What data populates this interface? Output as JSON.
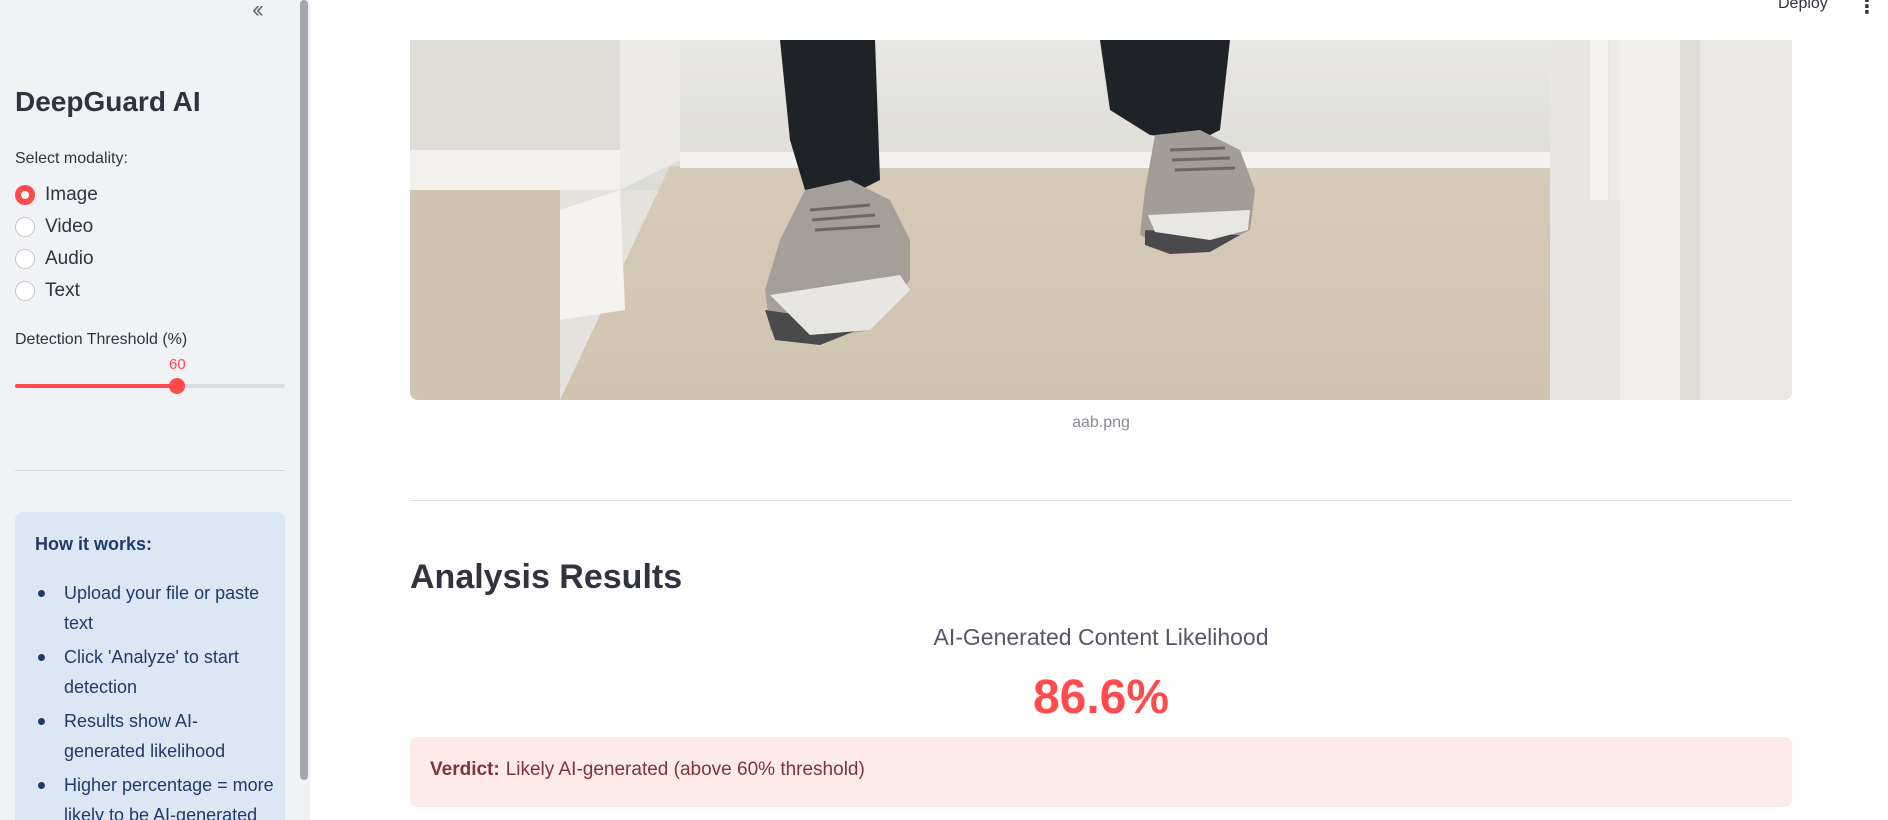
{
  "sidebar": {
    "collapse_icon": "double-chevron-left-icon",
    "title": "DeepGuard AI",
    "modality_label": "Select modality:",
    "modalities": [
      {
        "label": "Image",
        "selected": true
      },
      {
        "label": "Video",
        "selected": false
      },
      {
        "label": "Audio",
        "selected": false
      },
      {
        "label": "Text",
        "selected": false
      }
    ],
    "threshold_label": "Detection Threshold (%)",
    "threshold_value": "60",
    "threshold": {
      "value": 60,
      "min": 0,
      "max": 100
    },
    "info": {
      "title": "How it works:",
      "items": [
        "Upload your file or paste text",
        "Click 'Analyze' to start detection",
        "Results show AI-generated likelihood",
        "Higher percentage = more likely to be AI-generated"
      ]
    }
  },
  "header": {
    "deploy_label": "Deploy",
    "menu_icon": "vertical-dots-icon"
  },
  "main": {
    "image_caption": "aab.png",
    "results_heading": "Analysis Results",
    "likelihood_label": "AI-Generated Content Likelihood",
    "likelihood_value": "86.6%",
    "verdict_label": "Verdict:",
    "verdict_text": "Likely AI-generated (above 60% threshold)"
  },
  "colors": {
    "accent": "#ff4b4b",
    "sidebar_bg": "#f0f2f6",
    "info_bg": "#dde7f4",
    "verdict_bg": "#ffeaea"
  }
}
